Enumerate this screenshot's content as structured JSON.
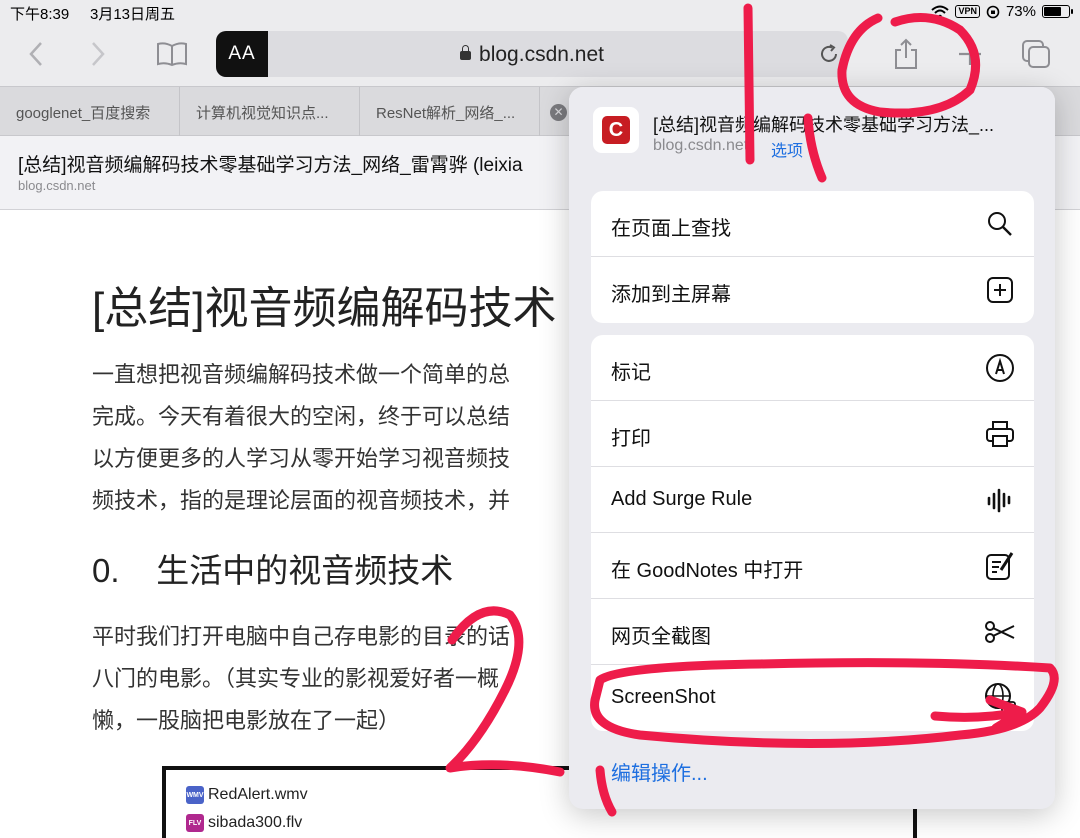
{
  "status_bar": {
    "time": "下午8:39",
    "date": "3月13日周五",
    "vpn": "VPN",
    "battery": "73%",
    "battery_level": 0.73
  },
  "toolbar": {
    "reader_aa": "AA",
    "url": "blog.csdn.net"
  },
  "tabs": [
    {
      "label": "googlenet_百度搜索"
    },
    {
      "label": "计算机视觉知识点..."
    },
    {
      "label": "ResNet解析_网络_..."
    }
  ],
  "page_header": {
    "title": "[总结]视音频编解码技术零基础学习方法_网络_雷霄骅 (leixia",
    "domain": "blog.csdn.net"
  },
  "article": {
    "heading": "[总结]视音频编解码技术",
    "para1": [
      "一直想把视音频编解码技术做一个简单的总",
      "完成。今天有着很大的空闲，终于可以总结",
      "以方便更多的人学习从零开始学习视音频技",
      "频技术，指的是理论层面的视音频技术，并"
    ],
    "section_heading": "0.    生活中的视音频技术",
    "para2": [
      "平时我们打开电脑中自己存电影的目录的话",
      "八门的电影。（其实专业的影视爱好者一概",
      "懒，一股脑把电影放在了一起）"
    ],
    "files": [
      {
        "name": "RedAlert.wmv",
        "tag": "WMV",
        "color": "#4a63c8"
      },
      {
        "name": "sibada300.flv",
        "tag": "FLV",
        "color": "#b0288e"
      }
    ]
  },
  "share_sheet": {
    "site_icon_letter": "C",
    "title": "[总结]视音频编解码技术零基础学习方法_...",
    "domain": "blog.csdn.net",
    "options_label": "选项",
    "group1": [
      {
        "label": "在页面上查找",
        "icon": "search-icon"
      },
      {
        "label": "添加到主屏幕",
        "icon": "add-square-icon"
      }
    ],
    "group2": [
      {
        "label": "标记",
        "icon": "markup-icon"
      },
      {
        "label": "打印",
        "icon": "printer-icon"
      },
      {
        "label": "Add Surge Rule",
        "icon": "waveform-icon"
      },
      {
        "label": "在 GoodNotes 中打开",
        "icon": "note-pencil-icon"
      },
      {
        "label": "网页全截图",
        "icon": "scissors-icon"
      },
      {
        "label": "ScreenShot",
        "icon": "globe-camera-icon"
      }
    ],
    "edit_actions": "编辑操作..."
  },
  "annotations": {
    "color": "#ee1c4a"
  }
}
